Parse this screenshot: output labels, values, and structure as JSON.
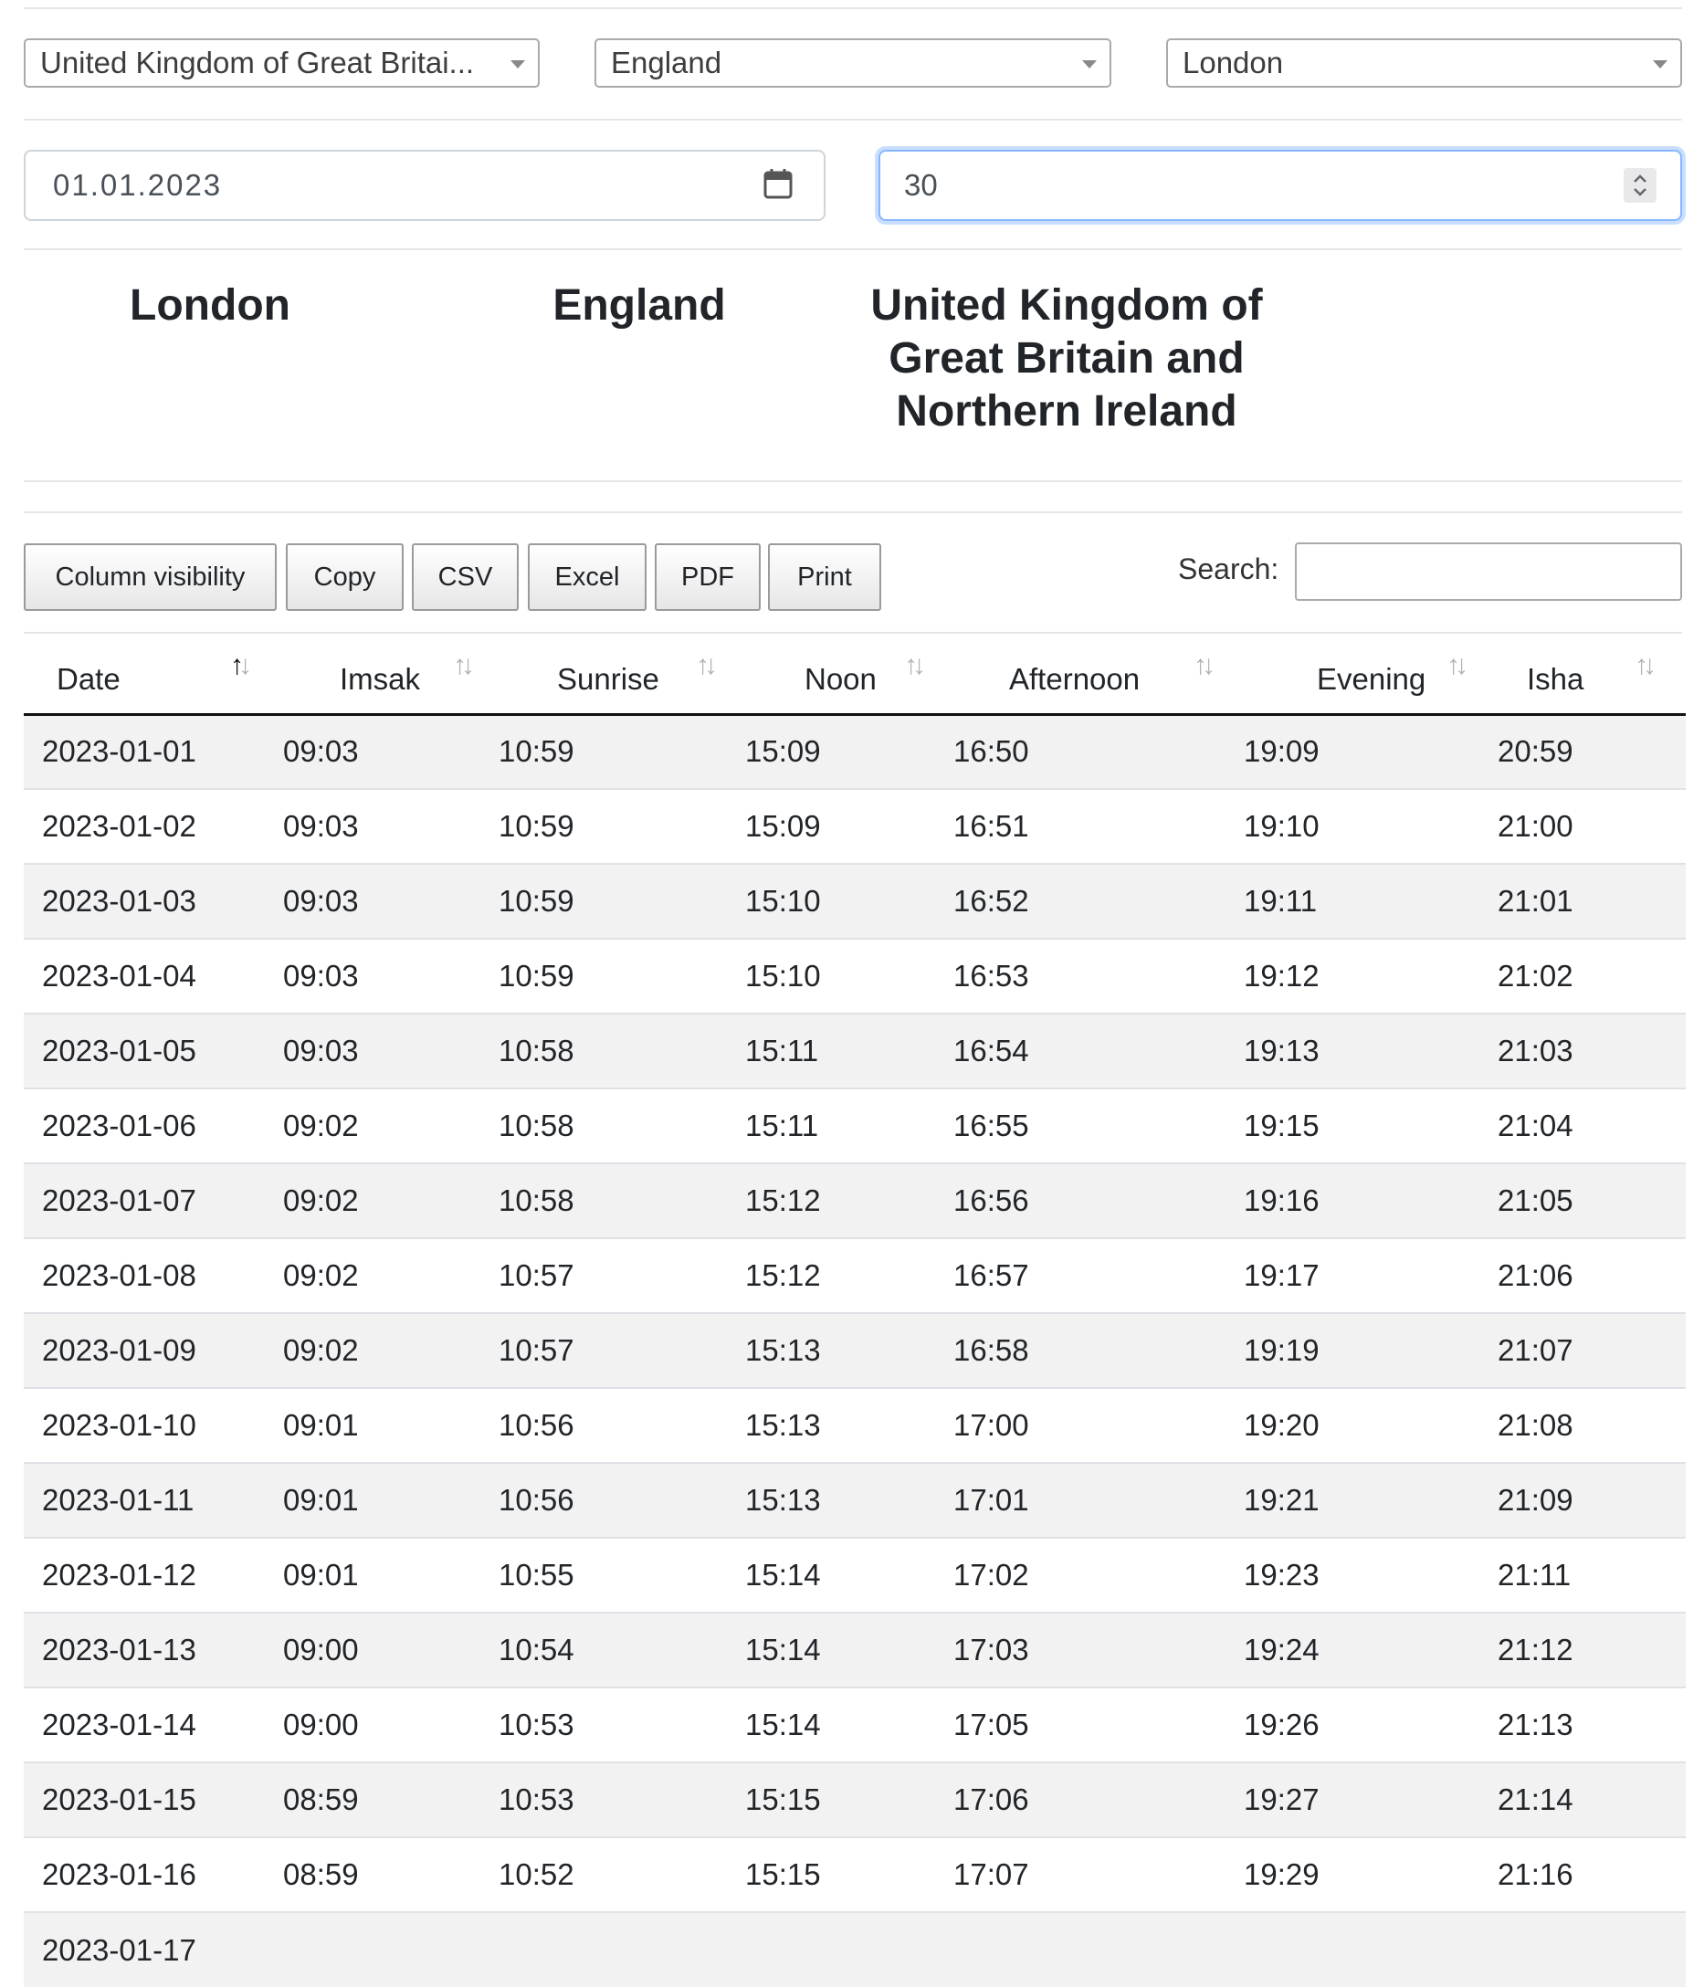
{
  "filters": {
    "country": "United Kingdom of Great Britai...",
    "region": "England",
    "city": "London",
    "date": "01.01.2023",
    "days": "30"
  },
  "location": {
    "city": "London",
    "region": "England",
    "country": "United Kingdom of Great Britain and Northern Ireland"
  },
  "toolbar": {
    "buttons": [
      "Column visibility",
      "Copy",
      "CSV",
      "Excel",
      "PDF",
      "Print"
    ],
    "search_label": "Search:",
    "search_value": ""
  },
  "table": {
    "columns": [
      "Date",
      "Imsak",
      "Sunrise",
      "Noon",
      "Afternoon",
      "Evening",
      "Isha"
    ],
    "sorted_column": "Date",
    "sort_direction": "ascending",
    "rows": [
      [
        "2023-01-01",
        "09:03",
        "10:59",
        "15:09",
        "16:50",
        "19:09",
        "20:59"
      ],
      [
        "2023-01-02",
        "09:03",
        "10:59",
        "15:09",
        "16:51",
        "19:10",
        "21:00"
      ],
      [
        "2023-01-03",
        "09:03",
        "10:59",
        "15:10",
        "16:52",
        "19:11",
        "21:01"
      ],
      [
        "2023-01-04",
        "09:03",
        "10:59",
        "15:10",
        "16:53",
        "19:12",
        "21:02"
      ],
      [
        "2023-01-05",
        "09:03",
        "10:58",
        "15:11",
        "16:54",
        "19:13",
        "21:03"
      ],
      [
        "2023-01-06",
        "09:02",
        "10:58",
        "15:11",
        "16:55",
        "19:15",
        "21:04"
      ],
      [
        "2023-01-07",
        "09:02",
        "10:58",
        "15:12",
        "16:56",
        "19:16",
        "21:05"
      ],
      [
        "2023-01-08",
        "09:02",
        "10:57",
        "15:12",
        "16:57",
        "19:17",
        "21:06"
      ],
      [
        "2023-01-09",
        "09:02",
        "10:57",
        "15:13",
        "16:58",
        "19:19",
        "21:07"
      ],
      [
        "2023-01-10",
        "09:01",
        "10:56",
        "15:13",
        "17:00",
        "19:20",
        "21:08"
      ],
      [
        "2023-01-11",
        "09:01",
        "10:56",
        "15:13",
        "17:01",
        "19:21",
        "21:09"
      ],
      [
        "2023-01-12",
        "09:01",
        "10:55",
        "15:14",
        "17:02",
        "19:23",
        "21:11"
      ],
      [
        "2023-01-13",
        "09:00",
        "10:54",
        "15:14",
        "17:03",
        "19:24",
        "21:12"
      ],
      [
        "2023-01-14",
        "09:00",
        "10:53",
        "15:14",
        "17:05",
        "19:26",
        "21:13"
      ],
      [
        "2023-01-15",
        "08:59",
        "10:53",
        "15:15",
        "17:06",
        "19:27",
        "21:14"
      ],
      [
        "2023-01-16",
        "08:59",
        "10:52",
        "15:15",
        "17:07",
        "19:29",
        "21:16"
      ],
      [
        "2023-01-17",
        "",
        "",
        "",
        "",
        "",
        ""
      ]
    ]
  }
}
